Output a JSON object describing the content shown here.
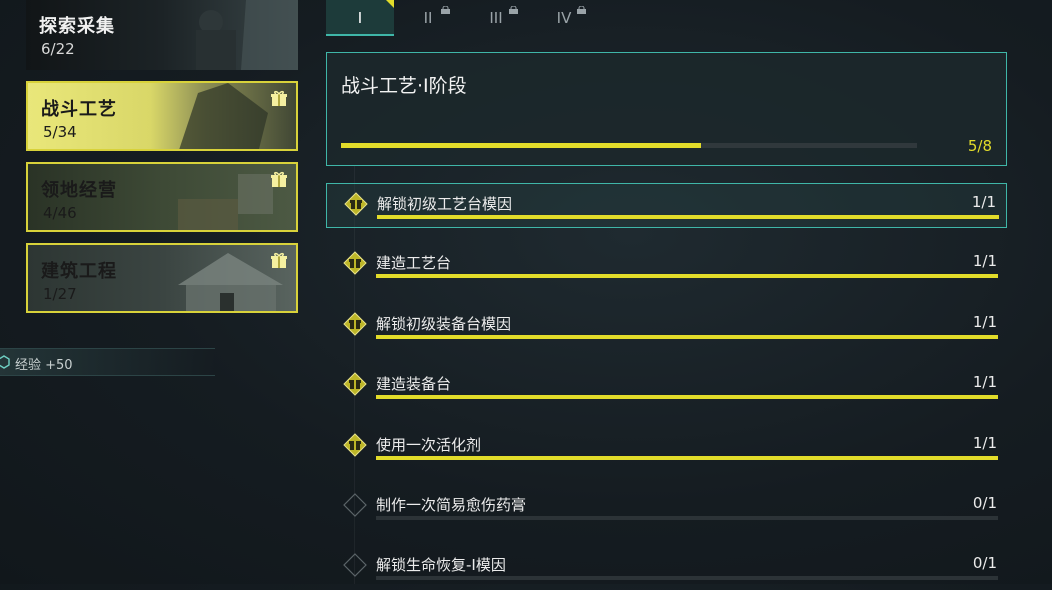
{
  "categories": [
    {
      "title": "探索采集",
      "count": "6/22"
    },
    {
      "title": "战斗工艺",
      "count": "5/34"
    },
    {
      "title": "领地经营",
      "count": "4/46"
    },
    {
      "title": "建筑工程",
      "count": "1/27"
    }
  ],
  "reward": {
    "text": "经验 +50"
  },
  "tabs": [
    "I",
    "II",
    "III",
    "IV"
  ],
  "stage": {
    "title": "战斗工艺·I阶段",
    "count": "5/8",
    "progress": 0.625
  },
  "tasks": [
    {
      "label": "解锁初级工艺台模因",
      "count": "1/1",
      "progress": 1
    },
    {
      "label": "建造工艺台",
      "count": "1/1",
      "progress": 1
    },
    {
      "label": "解锁初级装备台模因",
      "count": "1/1",
      "progress": 1
    },
    {
      "label": "建造装备台",
      "count": "1/1",
      "progress": 1
    },
    {
      "label": "使用一次活化剂",
      "count": "1/1",
      "progress": 1
    },
    {
      "label": "制作一次简易愈伤药膏",
      "count": "0/1",
      "progress": 0
    },
    {
      "label": "解锁生命恢复-I模因",
      "count": "0/1",
      "progress": 0
    }
  ],
  "colors": {
    "accent_teal": "#3fb6a8",
    "progress_yellow": "#e2dc2a",
    "active_card": "#d8d23a"
  }
}
